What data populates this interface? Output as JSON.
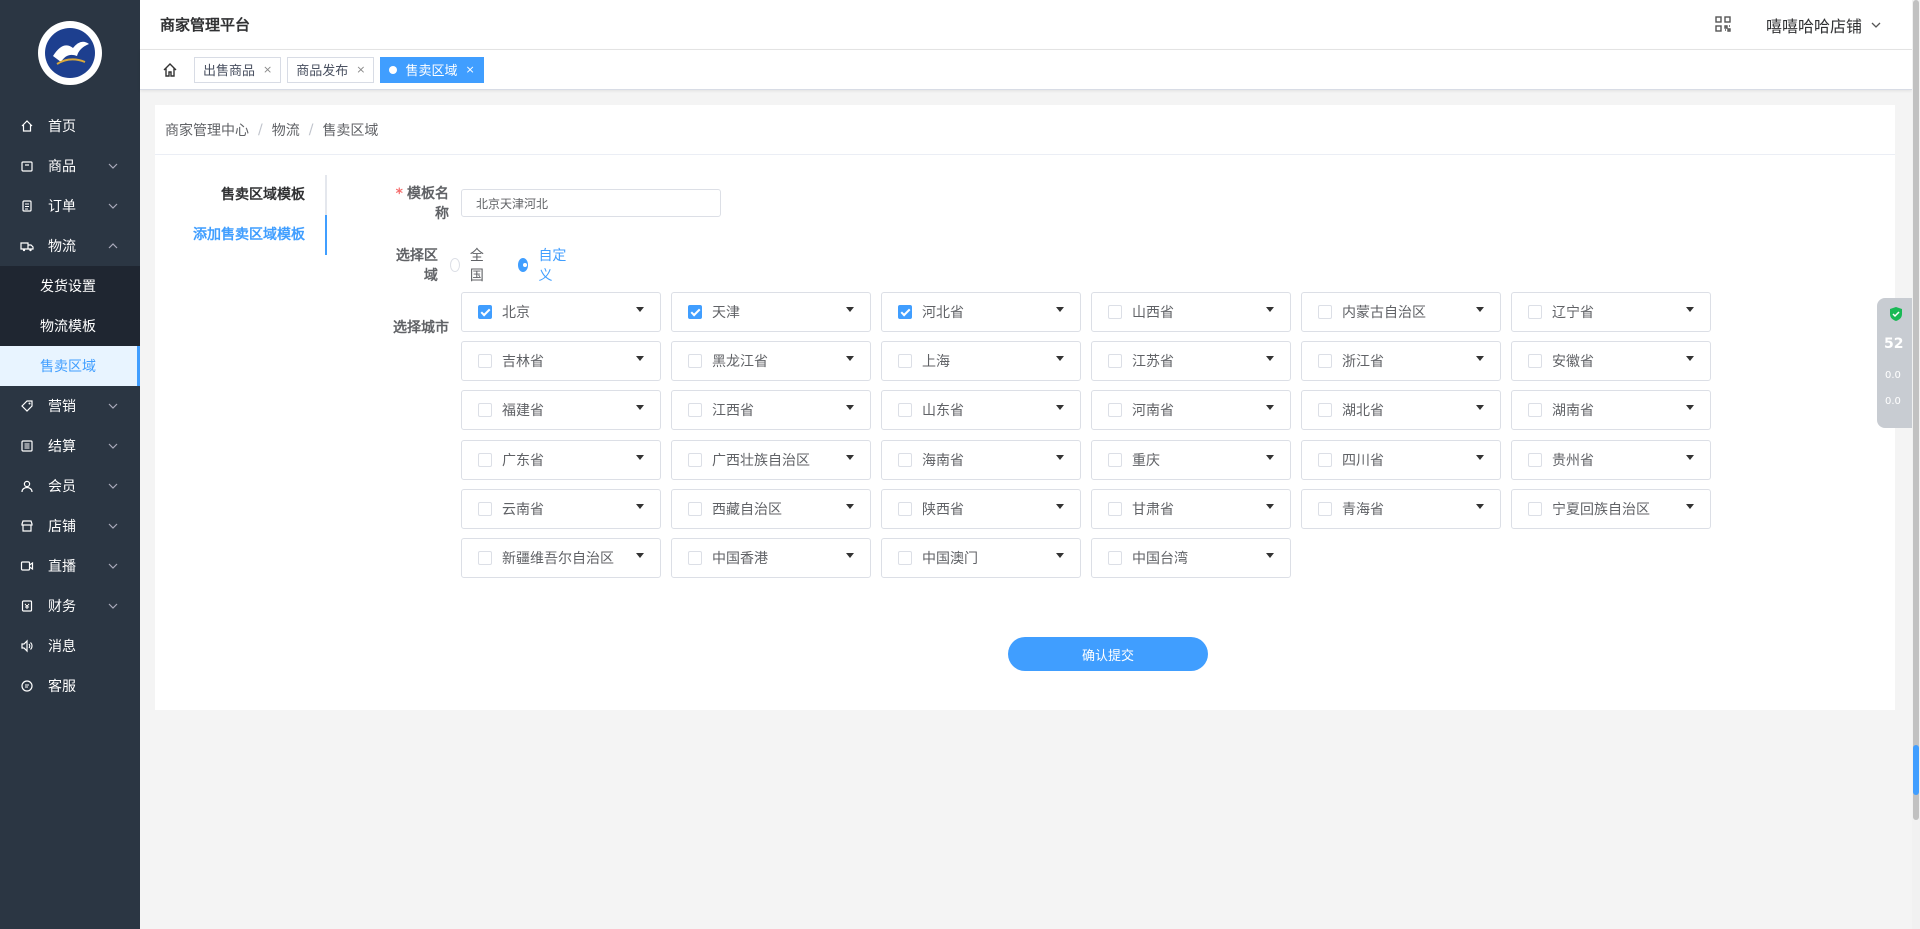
{
  "header": {
    "app_title": "商家管理平台",
    "user_name": "嘻嘻哈哈店铺"
  },
  "sidebar": {
    "items": [
      {
        "label": "首页",
        "icon": "home-icon"
      },
      {
        "label": "商品",
        "icon": "goods-icon"
      },
      {
        "label": "订单",
        "icon": "order-icon"
      },
      {
        "label": "物流",
        "icon": "truck-icon",
        "expanded": true
      },
      {
        "label": "营销",
        "icon": "tag-icon"
      },
      {
        "label": "结算",
        "icon": "settle-icon"
      },
      {
        "label": "会员",
        "icon": "user-icon"
      },
      {
        "label": "店铺",
        "icon": "store-icon"
      },
      {
        "label": "直播",
        "icon": "live-icon"
      },
      {
        "label": "财务",
        "icon": "finance-icon"
      },
      {
        "label": "消息",
        "icon": "speaker-icon"
      },
      {
        "label": "客服",
        "icon": "service-icon"
      }
    ],
    "logistics_sub": [
      "发货设置",
      "物流模板",
      "售卖区域"
    ],
    "active_sub": "售卖区域"
  },
  "tags": [
    {
      "label": "出售商品",
      "active": false
    },
    {
      "label": "商品发布",
      "active": false
    },
    {
      "label": "售卖区域",
      "active": true
    }
  ],
  "breadcrumb": [
    "商家管理中心",
    "物流",
    "售卖区域"
  ],
  "side_tabs": [
    "售卖区域模板",
    "添加售卖区域模板"
  ],
  "form": {
    "name_label": "模板名称",
    "name_value": "北京天津河北",
    "region_label": "选择区域",
    "region_options": [
      "全国",
      "自定义"
    ],
    "region_selected": "自定义",
    "city_label": "选择城市",
    "provinces": [
      {
        "name": "北京",
        "checked": true
      },
      {
        "name": "天津",
        "checked": true
      },
      {
        "name": "河北省",
        "checked": true
      },
      {
        "name": "山西省",
        "checked": false
      },
      {
        "name": "内蒙古自治区",
        "checked": false
      },
      {
        "name": "辽宁省",
        "checked": false
      },
      {
        "name": "吉林省",
        "checked": false
      },
      {
        "name": "黑龙江省",
        "checked": false
      },
      {
        "name": "上海",
        "checked": false
      },
      {
        "name": "江苏省",
        "checked": false
      },
      {
        "name": "浙江省",
        "checked": false
      },
      {
        "name": "安徽省",
        "checked": false
      },
      {
        "name": "福建省",
        "checked": false
      },
      {
        "name": "江西省",
        "checked": false
      },
      {
        "name": "山东省",
        "checked": false
      },
      {
        "name": "河南省",
        "checked": false
      },
      {
        "name": "湖北省",
        "checked": false
      },
      {
        "name": "湖南省",
        "checked": false
      },
      {
        "name": "广东省",
        "checked": false
      },
      {
        "name": "广西壮族自治区",
        "checked": false
      },
      {
        "name": "海南省",
        "checked": false
      },
      {
        "name": "重庆",
        "checked": false
      },
      {
        "name": "四川省",
        "checked": false
      },
      {
        "name": "贵州省",
        "checked": false
      },
      {
        "name": "云南省",
        "checked": false
      },
      {
        "name": "西藏自治区",
        "checked": false
      },
      {
        "name": "陕西省",
        "checked": false
      },
      {
        "name": "甘肃省",
        "checked": false
      },
      {
        "name": "青海省",
        "checked": false
      },
      {
        "name": "宁夏回族自治区",
        "checked": false
      },
      {
        "name": "新疆维吾尔自治区",
        "checked": false
      },
      {
        "name": "中国香港",
        "checked": false
      },
      {
        "name": "中国澳门",
        "checked": false
      },
      {
        "name": "中国台湾",
        "checked": false
      }
    ],
    "submit_label": "确认提交"
  },
  "widget": {
    "percent": "52",
    "up_speed": "0.0",
    "down_speed": "0.0"
  },
  "colors": {
    "accent": "#409eff",
    "sidebar_bg": "#2b3643",
    "required": "#f56c6c"
  }
}
